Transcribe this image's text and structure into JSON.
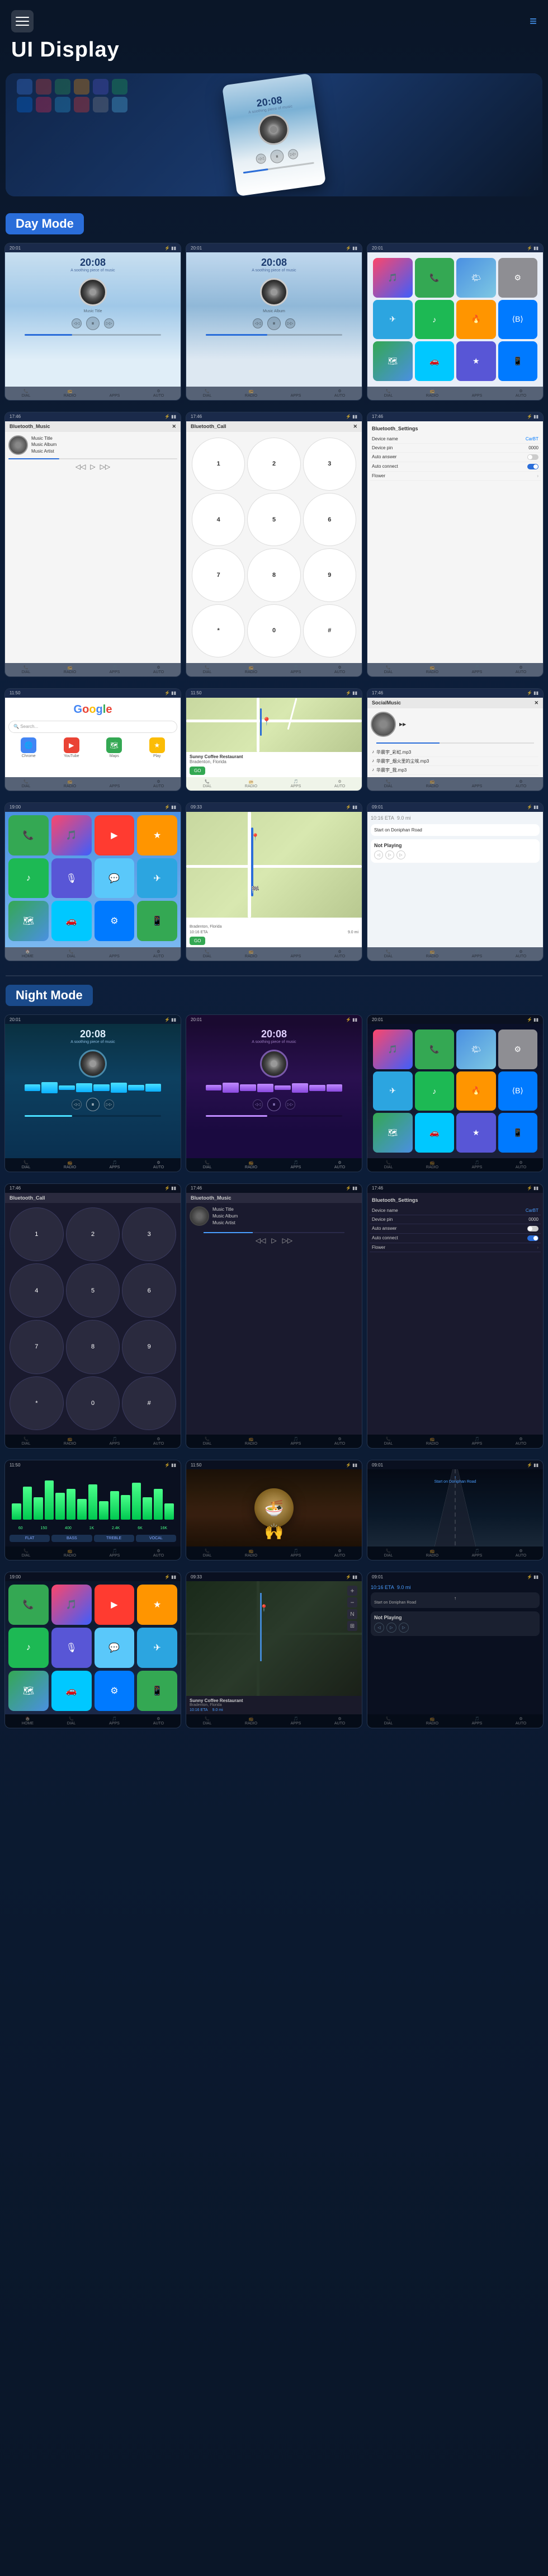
{
  "header": {
    "title": "UI Display",
    "menu_label": "≡"
  },
  "sections": {
    "day_mode": "Day Mode",
    "night_mode": "Night Mode"
  },
  "music": {
    "time": "20:08",
    "subtitle": "A soothing piece of music",
    "title": "Music Title",
    "album": "Music Album",
    "artist": "Music Artist"
  },
  "settings": {
    "title": "Bluetooth_Settings",
    "device_name_label": "Device name",
    "device_name_value": "CarBT",
    "device_pin_label": "Device pin",
    "device_pin_value": "0000",
    "auto_answer_label": "Auto answer",
    "auto_connect_label": "Auto connect",
    "flower_label": "Flower"
  },
  "bluetooth_music": {
    "title": "Bluetooth_Music"
  },
  "bluetooth_call": {
    "title": "Bluetooth_Call"
  },
  "navigation": {
    "title": "Sunny Coffee Restaurant",
    "address": "Bradenton, Florida",
    "go_label": "GO",
    "eta": "10:16 ETA",
    "distance": "9.0 mi",
    "direction": "Start on Doniphan Road"
  },
  "not_playing": {
    "label": "Not Playing"
  },
  "dial_keys": [
    "1",
    "2",
    "3",
    "4",
    "5",
    "6",
    "7",
    "8",
    "9",
    "*",
    "0",
    "#"
  ],
  "google": {
    "logo": "Google",
    "search_placeholder": "Search..."
  },
  "social_music": {
    "title": "SocialMusic",
    "songs": [
      "华晨宇_彩虹.mp3",
      "华晨宇_烟火里的尘埃.mp3",
      "华晨宇_我.mp3"
    ]
  }
}
